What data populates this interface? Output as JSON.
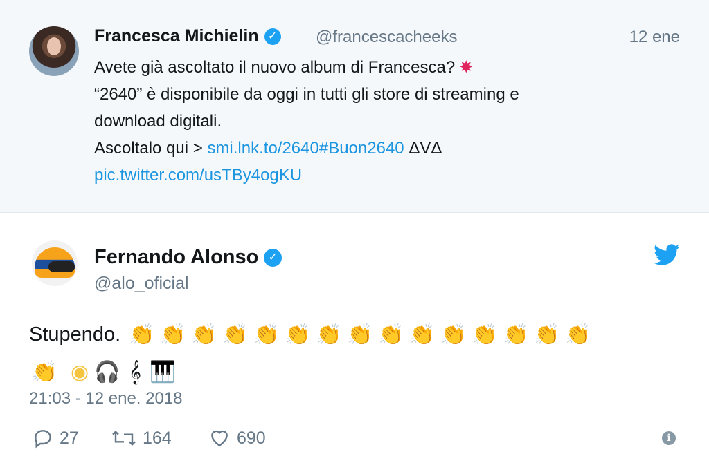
{
  "quoted": {
    "name": "Francesca Michielin",
    "handle": "@francescacheeks",
    "time": "12 ene",
    "line1": "Avete già ascoltato il nuovo album di Francesca?",
    "line2": "“2640” è disponibile da oggi in tutti gli store di streaming e",
    "line3": "download digitali.",
    "line4_prefix": "Ascoltalo qui > ",
    "link": "smi.lnk.to/2640",
    "hashtag": "#Buon2640",
    "line4_suffix": " ΔVΔ",
    "pic_link": "pic.twitter.com/usTBy4ogKU"
  },
  "tweet": {
    "name": "Fernando Alonso",
    "handle": "@alo_oficial",
    "text": "Stupendo.",
    "clap_count_row1": 16,
    "clap_count_row2": 1,
    "emojis": [
      "clap",
      "cd",
      "headphones",
      "music-score",
      "piano"
    ],
    "timestamp": "21:03 - 12 ene. 2018"
  },
  "actions": {
    "replies": "27",
    "retweets": "164",
    "likes": "690"
  },
  "colors": {
    "link": "#1b95e0",
    "verified": "#1da1f2",
    "muted": "#657786"
  }
}
